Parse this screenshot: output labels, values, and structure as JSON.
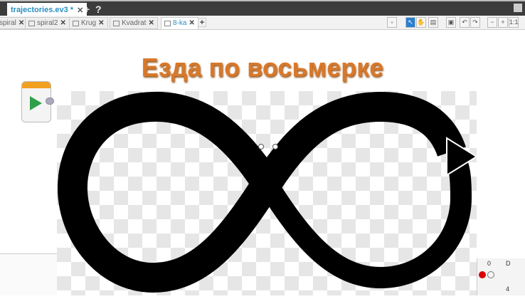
{
  "project_tab": {
    "label": "trajectories.ev3 *",
    "close": "✕"
  },
  "top_buttons": {
    "add": "+",
    "help": "?"
  },
  "program_tabs": [
    {
      "label": "spiral"
    },
    {
      "label": "spiral2"
    },
    {
      "label": "Krug"
    },
    {
      "label": "Kvadrat"
    },
    {
      "label": "8-ka",
      "active": true
    }
  ],
  "tab_close": "✕",
  "tab_add": "+",
  "toolbar": [
    {
      "name": "comment",
      "glyph": "▫"
    },
    {
      "name": "select",
      "glyph": "↖"
    },
    {
      "name": "pan",
      "glyph": "✋"
    },
    {
      "name": "content-editor",
      "glyph": "▤"
    },
    {
      "name": "save",
      "glyph": "▣"
    },
    {
      "name": "undo",
      "glyph": "↶"
    },
    {
      "name": "redo",
      "glyph": "↷"
    },
    {
      "name": "zoom-out",
      "glyph": "−"
    },
    {
      "name": "zoom-in",
      "glyph": "+"
    },
    {
      "name": "zoom-reset",
      "glyph": "1:1"
    }
  ],
  "heading": "Езда по восьмерке",
  "bottom_panel": {
    "col1": "0",
    "col2": "D",
    "row2": "4"
  },
  "colors": {
    "heading": "#d8782a",
    "accent": "#2a8fc1",
    "start_block": "#f2a020",
    "play": "#2fa04a"
  }
}
